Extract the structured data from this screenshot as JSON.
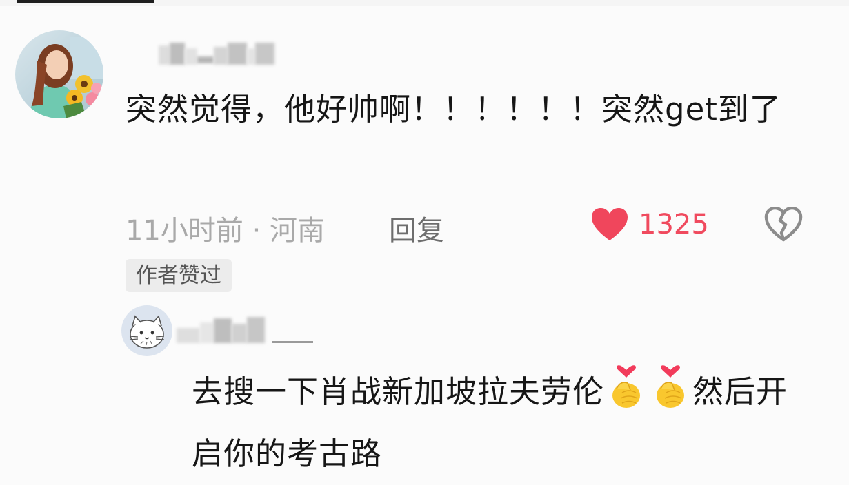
{
  "comment": {
    "text": "突然觉得，他好帅啊！！！！！！突然get到了",
    "time_location": "11小时前 · 河南",
    "reply_label": "回复",
    "like_count": "1325",
    "author_badge": "作者赞过"
  },
  "reply": {
    "text_before_emoji": "去搜一下肖战新加坡拉夫劳伦",
    "emojis": [
      "finger-heart-emoji",
      "finger-heart-emoji"
    ],
    "text_after_emoji": "然后开启你的考古路"
  },
  "icons": {
    "like": "heart-filled-icon",
    "dislike": "broken-heart-icon"
  },
  "colors": {
    "like_red": "#f04a5e",
    "meta_gray": "#a9a9a9",
    "badge_bg": "#ececec"
  }
}
